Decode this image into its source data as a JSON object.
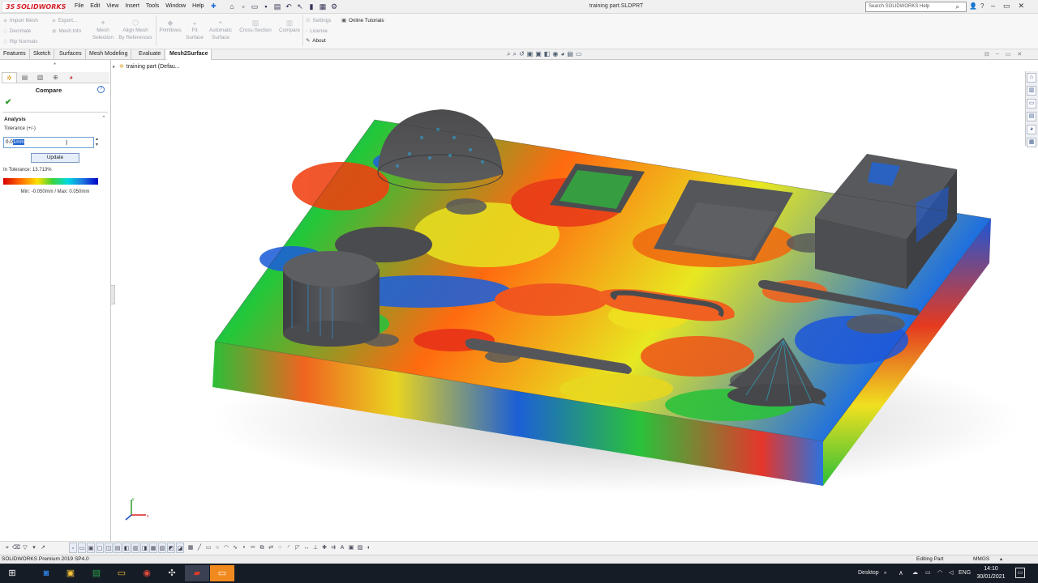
{
  "app": {
    "brand": "SOLIDWORKS",
    "document_title": "training part.SLDPRT",
    "menu": [
      "File",
      "Edit",
      "View",
      "Insert",
      "Tools",
      "Window",
      "Help"
    ],
    "search_placeholder": "Search SOLIDWORKS Help"
  },
  "command_manager": {
    "small_items": [
      "Import Mesh",
      "Decimate",
      "Rip Normals",
      "Export...",
      "Mesh Info"
    ],
    "big_items": [
      {
        "line1": "Mesh",
        "line2": "Selection"
      },
      {
        "line1": "Align Mesh",
        "line2": "By References"
      },
      {
        "line1": "Primitives",
        "line2": ""
      },
      {
        "line1": "Fit",
        "line2": "Surface"
      },
      {
        "line1": "Automatic",
        "line2": "Surface"
      },
      {
        "line1": "Cross-Section",
        "line2": ""
      },
      {
        "line1": "Compare",
        "line2": ""
      }
    ],
    "right_items": {
      "settings": "Settings",
      "license": "License",
      "about": "About",
      "tutorials": "Online Tutorials"
    }
  },
  "tabs": [
    {
      "label": "Features",
      "active": false
    },
    {
      "label": "Sketch",
      "active": false
    },
    {
      "label": "Surfaces",
      "active": false
    },
    {
      "label": "Mesh Modeling",
      "active": false
    },
    {
      "label": "Evaluate",
      "active": false
    },
    {
      "label": "Mesh2Surface",
      "active": true
    }
  ],
  "feature_tree": {
    "item": "training part  (Defau..."
  },
  "property_manager": {
    "title": "Compare",
    "group": "Analysis",
    "tolerance_label": "Tolerance (+/-)",
    "tolerance_pre": "0.0",
    "tolerance_selected": "1mm",
    "update_label": "Update",
    "in_tolerance": "In Tolerance: 13.713%",
    "min_max": "Min: -0.050mm / Max: 0.050mm",
    "scale_colors": [
      "#d80000",
      "#ff6a00",
      "#ffe000",
      "#3cd23c",
      "#00d8e0",
      "#1e74e0",
      "#0000c8"
    ]
  },
  "status": {
    "product": "SOLIDWORKS Premium 2019 SP4.0",
    "mode": "Editing Part",
    "units": "MMGS"
  },
  "taskbar": {
    "desktop": "Desktop",
    "lang": "ENG",
    "time": "14:10",
    "date": "30/01/2021"
  }
}
